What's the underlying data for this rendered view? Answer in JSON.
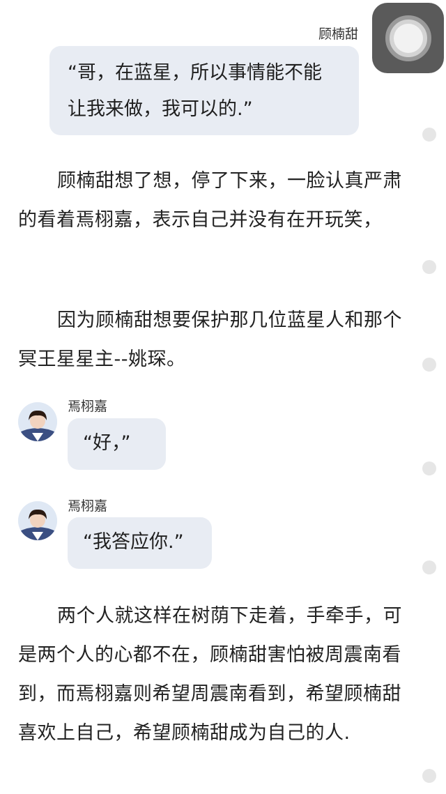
{
  "chat1": {
    "speaker": "顾楠甜",
    "lines": [
      "“哥，在蓝星，所以事情能不能",
      "让我来做，我可以的.”"
    ]
  },
  "para1": "顾楠甜想了想，停了下来，一脸认真严肃的看着焉栩嘉，表示自己并没有在开玩笑，",
  "para2": "因为顾楠甜想要保护那几位蓝星人和那个冥王星星主--姚琛。",
  "chat2": {
    "speaker": "焉栩嘉",
    "text": "“好，”"
  },
  "chat3": {
    "speaker": "焉栩嘉",
    "text": "“我答应你.”"
  },
  "para3": "两个人就这样在树荫下走着，手牵手，可是两个人的心都不在，顾楠甜害怕被周震南看到，而焉栩嘉则希望周震南看到，希望顾楠甜喜欢上自己，希望顾楠甜成为自己的人.",
  "icons": {
    "assistive_touch": "assistive-touch-icon",
    "avatar": "avatar-photo-icon"
  },
  "colors": {
    "bubble": "#e8ecf3",
    "text": "#222222",
    "assistive_bg": "#5a5a5a"
  }
}
